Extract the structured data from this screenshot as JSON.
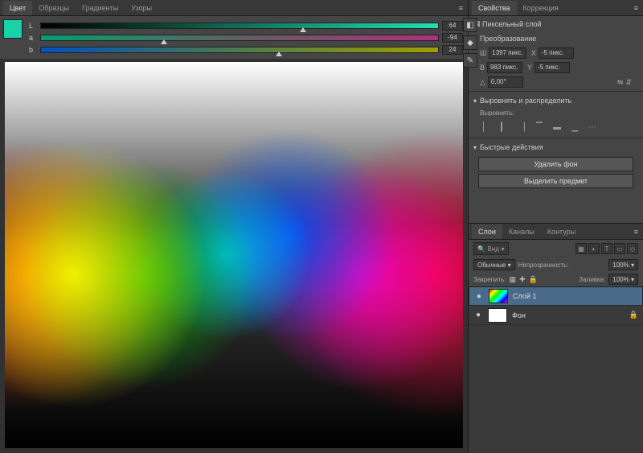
{
  "color_panel": {
    "tabs": [
      "Цвет",
      "Образцы",
      "Градиенты",
      "Узоры"
    ],
    "active_tab": 0,
    "channels": [
      {
        "label": "L",
        "value": "64",
        "thumb_pct": 66
      },
      {
        "label": "a",
        "value": "-94",
        "thumb_pct": 31
      },
      {
        "label": "b",
        "value": "24",
        "thumb_pct": 60
      }
    ]
  },
  "properties_panel": {
    "tabs": [
      "Свойства",
      "Коррекция"
    ],
    "active_tab": 0,
    "layer_type": "Пиксельный слой",
    "transform_section": "Преобразование",
    "width_label": "Ш",
    "width_value": "1397 пикс.",
    "x_label": "X",
    "x_value": "-5 пикс.",
    "height_label": "В",
    "height_value": "983 пикс.",
    "y_label": "Y",
    "y_value": "-5 пикс.",
    "angle_value": "0,00°",
    "align_section": "Выровнять и распределить",
    "align_sub": "Выровнять:",
    "quick_section": "Быстрые действия",
    "btn_remove_bg": "Удалить фон",
    "btn_select_subj": "Выделить предмет"
  },
  "layers_panel": {
    "tabs": [
      "Слои",
      "Каналы",
      "Контуры"
    ],
    "active_tab": 0,
    "filter_label": "Вид",
    "blend_mode": "Обычные",
    "opacity_label": "Непрозрачность:",
    "opacity": "100%",
    "lock_label": "Закрепить:",
    "fill_label": "Заливка:",
    "fill": "100%",
    "layers": [
      {
        "name": "Слой 1",
        "thumb": "t1",
        "selected": true,
        "locked": false
      },
      {
        "name": "Фон",
        "thumb": "t2",
        "selected": false,
        "locked": true
      }
    ]
  }
}
